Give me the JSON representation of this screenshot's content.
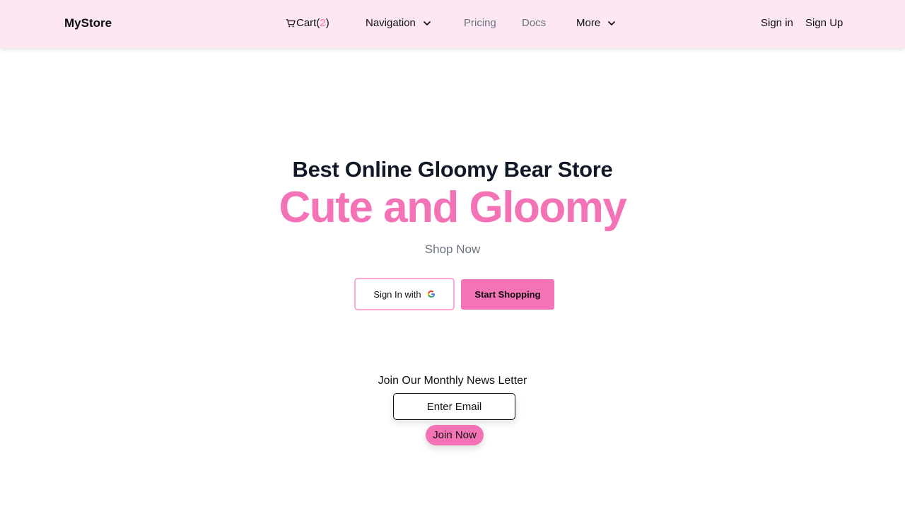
{
  "navbar": {
    "brand": "MyStore",
    "cart": {
      "label": "Cart",
      "open_paren": "(",
      "count": "2",
      "close_paren": ")"
    },
    "navigation_label": "Navigation",
    "pricing_label": "Pricing",
    "docs_label": "Docs",
    "more_label": "More",
    "sign_in_label": "Sign in",
    "sign_up_label": "Sign Up"
  },
  "hero": {
    "title": "Best Online Gloomy Bear Store",
    "subtitle": "Cute and Gloomy",
    "tagline": "Shop Now",
    "google_button_label": "Sign In with",
    "start_button_label": "Start Shopping"
  },
  "newsletter": {
    "label": "Join Our Monthly News Letter",
    "email_placeholder": "Enter Email",
    "join_label": "Join Now"
  },
  "colors": {
    "navbar_bg": "#fce7f3",
    "accent": "#f472b6",
    "accent_border": "#f9a8d4",
    "muted_text": "#6b7280",
    "heading": "#111827"
  },
  "icons": [
    "cart-icon",
    "chevron-down-icon",
    "google-icon"
  ]
}
